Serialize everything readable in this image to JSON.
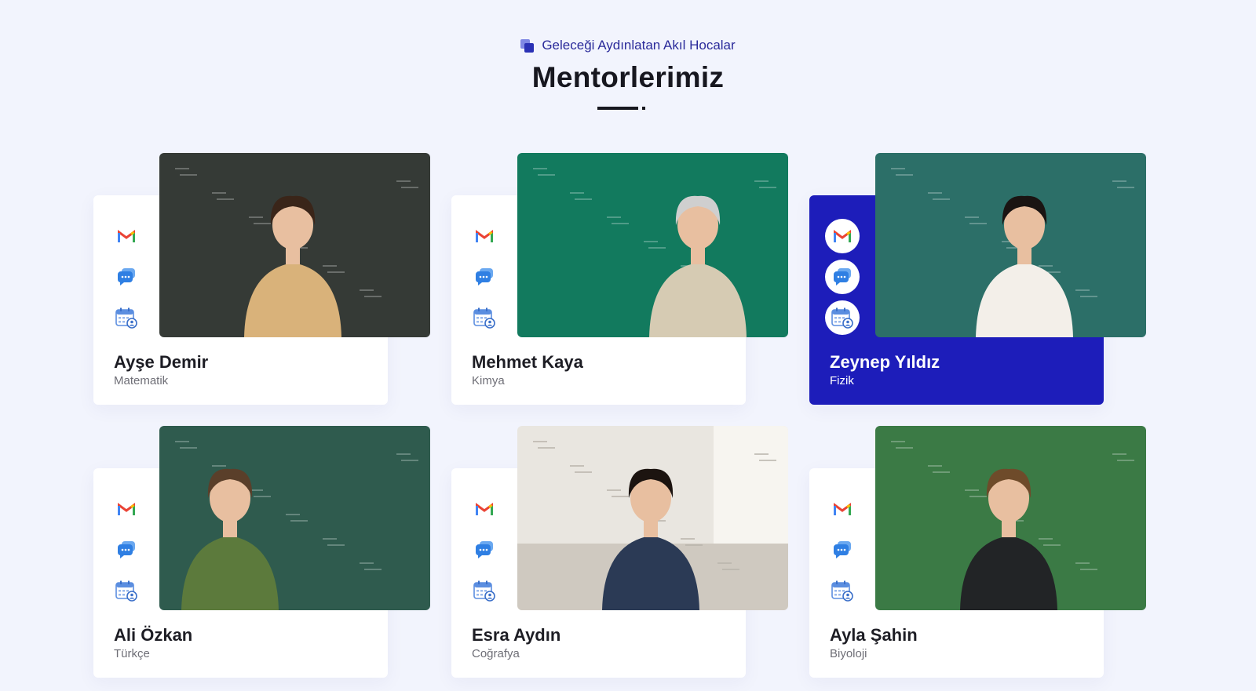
{
  "header": {
    "eyebrow": "Geleceği Aydınlatan Akıl Hocalar",
    "title": "Mentorlerimiz"
  },
  "mentors": [
    {
      "name": "Ayşe Demir",
      "subject": "Matematik",
      "active": false,
      "board_color": "#353a36"
    },
    {
      "name": "Mehmet Kaya",
      "subject": "Kimya",
      "active": false,
      "board_color": "#127a5e"
    },
    {
      "name": "Zeynep Yıldız",
      "subject": "Fizik",
      "active": true,
      "board_color": "#2c6f68"
    },
    {
      "name": "Ali Özkan",
      "subject": "Türkçe",
      "active": false,
      "board_color": "#2f5b4e"
    },
    {
      "name": "Esra Aydın",
      "subject": "Coğrafya",
      "active": false,
      "board_color": "#d9d4cc"
    },
    {
      "name": "Ayla Şahin",
      "subject": "Biyoloji",
      "active": false,
      "board_color": "#3b7a45"
    }
  ],
  "card_icons": [
    "gmail-icon",
    "chat-icon",
    "calendar-icon"
  ],
  "colors": {
    "accent": "#1d1dba",
    "background": "#f2f4fd",
    "title": "#17171f",
    "eyebrow": "#2a2a9a"
  }
}
